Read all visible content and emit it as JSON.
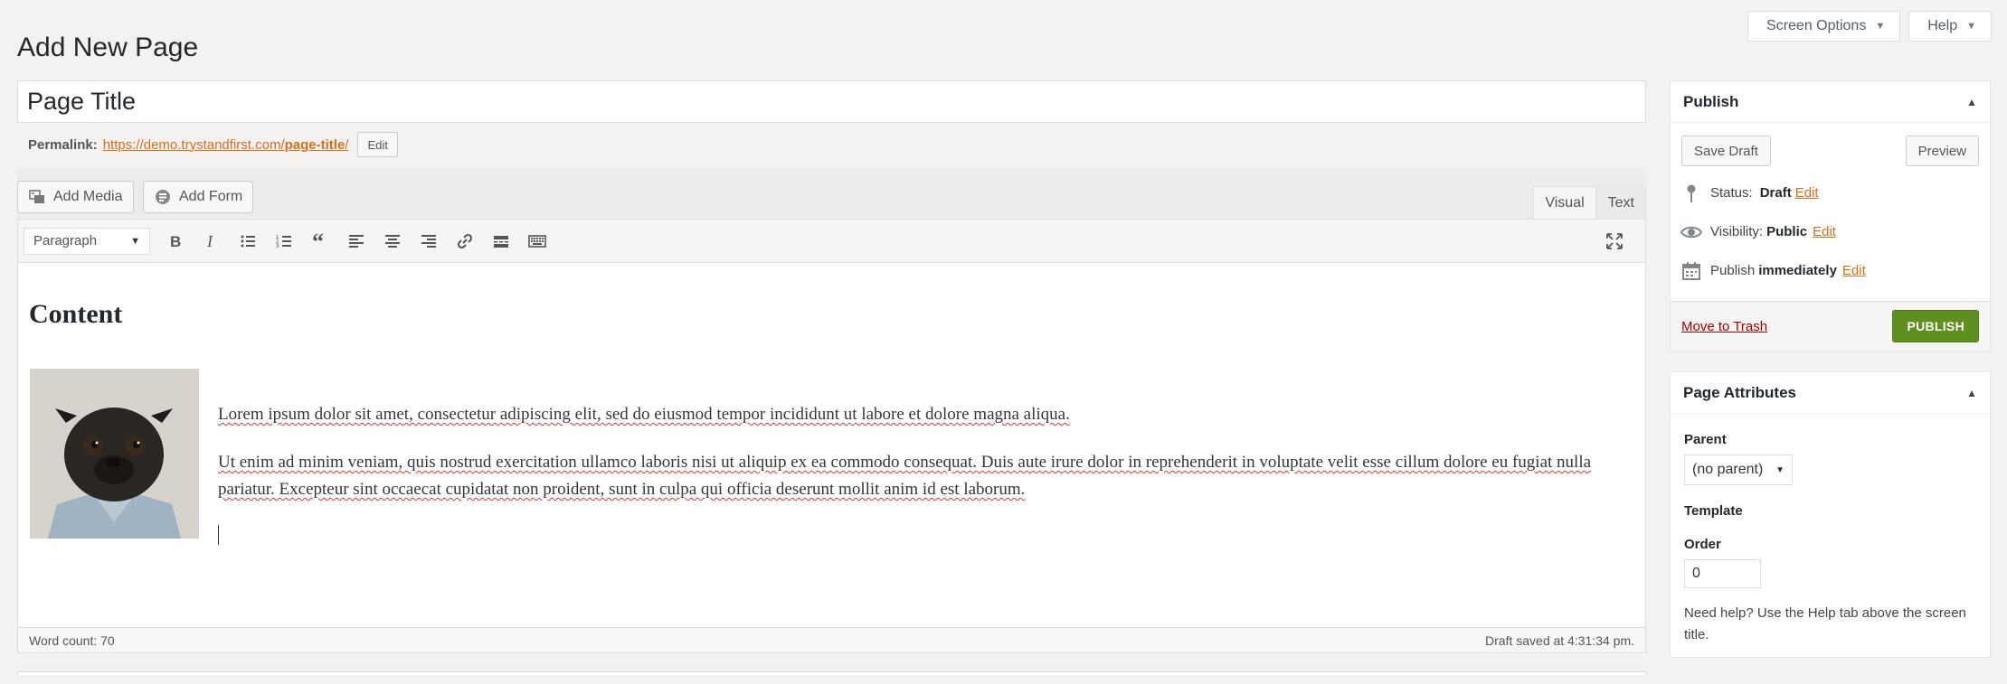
{
  "screen_meta": {
    "screen_options": "Screen Options",
    "help": "Help"
  },
  "page_heading": "Add New Page",
  "title_value": "Page Title",
  "permalink": {
    "label": "Permalink:",
    "url_base": "https://demo.trystandfirst.com/",
    "url_slug": "page-title",
    "url_end": "/",
    "edit": "Edit"
  },
  "media_buttons": {
    "add_media": "Add Media",
    "add_form": "Add Form"
  },
  "editor_tabs": {
    "visual": "Visual",
    "text": "Text"
  },
  "toolbar": {
    "format_value": "Paragraph",
    "icons": [
      "bold-icon",
      "italic-icon",
      "bullet-list-icon",
      "numbered-list-icon",
      "blockquote-icon",
      "align-left-icon",
      "align-center-icon",
      "align-right-icon",
      "link-icon",
      "read-more-icon",
      "toolbar-toggle-icon",
      "fullscreen-icon"
    ]
  },
  "content": {
    "heading": "Content",
    "para1": "Lorem ipsum dolor sit amet, consectetur adipiscing elit, sed do eiusmod tempor incididunt ut labore et dolore magna aliqua.",
    "para2": "Ut enim ad minim veniam, quis nostrud exercitation ullamco laboris nisi ut aliquip ex ea commodo consequat. Duis aute irure dolor in reprehenderit in voluptate velit esse cillum dolore eu fugiat nulla pariatur. Excepteur sint occaecat cupidatat non proident, sunt in culpa qui officia deserunt mollit anim id est laborum."
  },
  "status_bar": {
    "word_count": "Word count: 70",
    "draft_saved": "Draft saved at 4:31:34 pm."
  },
  "publish_box": {
    "title": "Publish",
    "save_draft": "Save Draft",
    "preview": "Preview",
    "status_label": "Status:",
    "status_value": "Draft",
    "visibility_label": "Visibility:",
    "visibility_value": "Public",
    "publish_label": "Publish",
    "publish_value": "immediately",
    "edit": "Edit",
    "move_to_trash": "Move to Trash",
    "publish_button": "PUBLISH"
  },
  "attributes_box": {
    "title": "Page Attributes",
    "parent_label": "Parent",
    "parent_value": "(no parent)",
    "template_label": "Template",
    "order_label": "Order",
    "order_value": "0",
    "help_text": "Need help? Use the Help tab above the screen title."
  },
  "colors": {
    "accent_link": "#d86e1a",
    "publish_button": "#5f8f1f",
    "trash_link": "#a00000",
    "background": "#f4f2f0"
  }
}
